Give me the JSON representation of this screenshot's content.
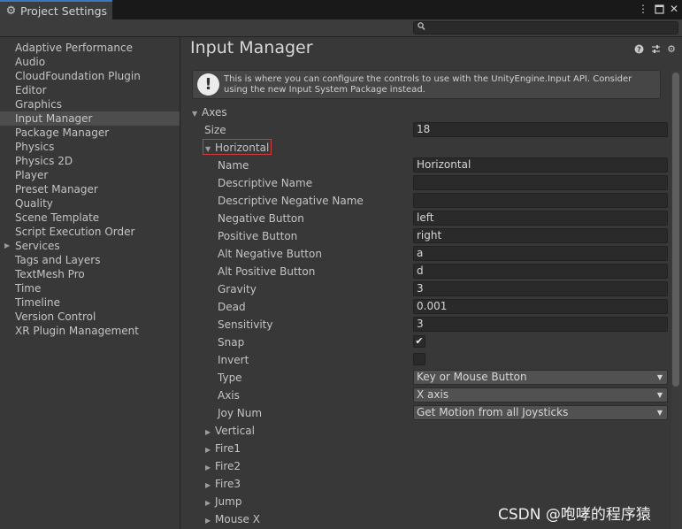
{
  "window": {
    "tab_title": "Project Settings",
    "tab_icon": "gear-icon"
  },
  "search": {
    "placeholder": ""
  },
  "sidebar": {
    "items": [
      {
        "label": "Adaptive Performance"
      },
      {
        "label": "Audio"
      },
      {
        "label": "CloudFoundation Plugin"
      },
      {
        "label": "Editor"
      },
      {
        "label": "Graphics"
      },
      {
        "label": "Input Manager",
        "selected": true
      },
      {
        "label": "Package Manager"
      },
      {
        "label": "Physics"
      },
      {
        "label": "Physics 2D"
      },
      {
        "label": "Player"
      },
      {
        "label": "Preset Manager"
      },
      {
        "label": "Quality"
      },
      {
        "label": "Scene Template"
      },
      {
        "label": "Script Execution Order"
      },
      {
        "label": "Services",
        "expandable": true
      },
      {
        "label": "Tags and Layers"
      },
      {
        "label": "TextMesh Pro"
      },
      {
        "label": "Time"
      },
      {
        "label": "Timeline"
      },
      {
        "label": "Version Control"
      },
      {
        "label": "XR Plugin Management"
      }
    ]
  },
  "main": {
    "title": "Input Manager",
    "info_text": "This is where you can configure the controls to use with the UnityEngine.Input API. Consider using the new Input System Package instead.",
    "axes_label": "Axes",
    "size_label": "Size",
    "size_value": "18",
    "expanded_axis": {
      "label": "Horizontal",
      "fields": {
        "name": {
          "label": "Name",
          "value": "Horizontal"
        },
        "descriptive_name": {
          "label": "Descriptive Name",
          "value": ""
        },
        "descriptive_negative_name": {
          "label": "Descriptive Negative Name",
          "value": ""
        },
        "negative_button": {
          "label": "Negative Button",
          "value": "left"
        },
        "positive_button": {
          "label": "Positive Button",
          "value": "right"
        },
        "alt_negative_button": {
          "label": "Alt Negative Button",
          "value": "a"
        },
        "alt_positive_button": {
          "label": "Alt Positive Button",
          "value": "d"
        },
        "gravity": {
          "label": "Gravity",
          "value": "3"
        },
        "dead": {
          "label": "Dead",
          "value": "0.001"
        },
        "sensitivity": {
          "label": "Sensitivity",
          "value": "3"
        },
        "snap": {
          "label": "Snap",
          "checked": true
        },
        "invert": {
          "label": "Invert",
          "checked": false
        },
        "type": {
          "label": "Type",
          "value": "Key or Mouse Button"
        },
        "axis": {
          "label": "Axis",
          "value": "X axis"
        },
        "joy_num": {
          "label": "Joy Num",
          "value": "Get Motion from all Joysticks"
        }
      }
    },
    "collapsed_axes": [
      {
        "label": "Vertical"
      },
      {
        "label": "Fire1"
      },
      {
        "label": "Fire2"
      },
      {
        "label": "Fire3"
      },
      {
        "label": "Jump"
      },
      {
        "label": "Mouse X"
      }
    ]
  },
  "watermark": "CSDN @咆哮的程序猿",
  "colors": {
    "accent": "#3a79bb",
    "highlight_border": "#d23b3b",
    "background": "#383838"
  }
}
